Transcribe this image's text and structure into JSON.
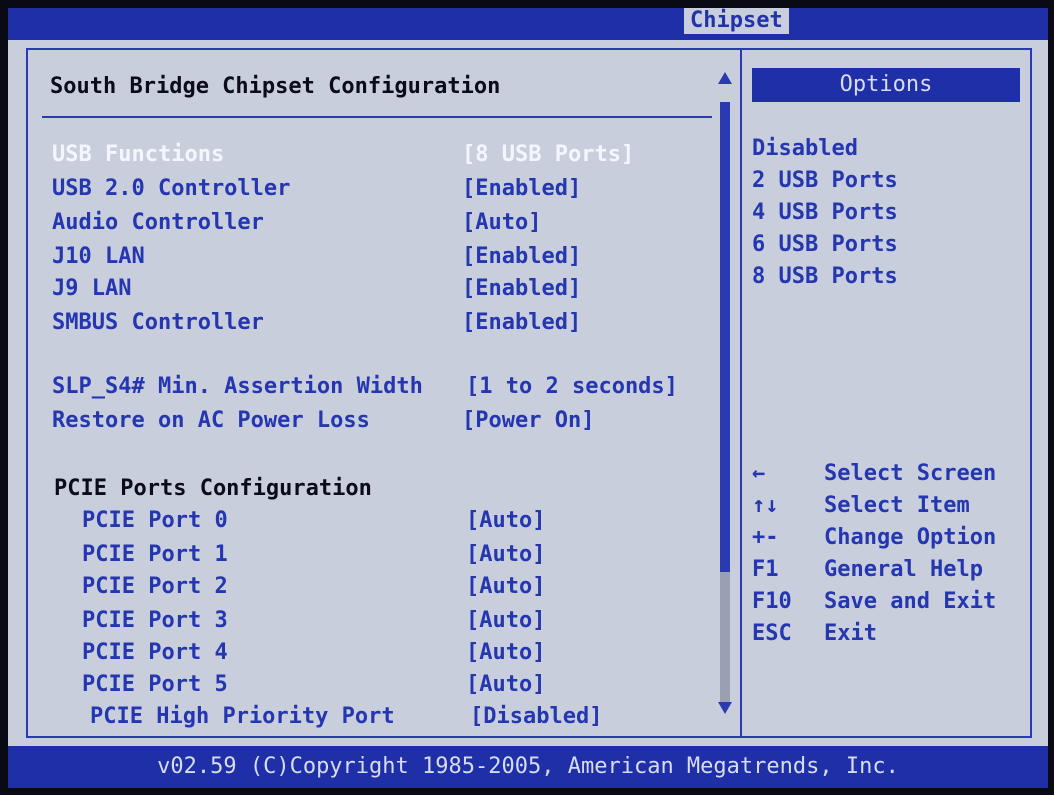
{
  "top_tab": "Chipset",
  "panel": {
    "title": "South Bridge Chipset Configuration",
    "rows": [
      {
        "label": "USB Functions",
        "value": "[8 USB Ports]"
      },
      {
        "label": "USB 2.0 Controller",
        "value": "[Enabled]"
      },
      {
        "label": "Audio Controller",
        "value": "[Auto]"
      },
      {
        "label": "J10 LAN",
        "value": "[Enabled]"
      },
      {
        "label": "J9 LAN",
        "value": "[Enabled]"
      },
      {
        "label": "SMBUS Controller",
        "value": "[Enabled]"
      },
      {
        "label": "SLP_S4# Min. Assertion Width",
        "value": "[1 to 2 seconds]"
      },
      {
        "label": "Restore on AC Power Loss",
        "value": "[Power On]"
      },
      {
        "label": "PCIE Ports Configuration",
        "value": ""
      },
      {
        "label": "PCIE Port 0",
        "value": "[Auto]"
      },
      {
        "label": "PCIE Port 1",
        "value": "[Auto]"
      },
      {
        "label": "PCIE Port 2",
        "value": "[Auto]"
      },
      {
        "label": "PCIE Port 3",
        "value": "[Auto]"
      },
      {
        "label": "PCIE Port 4",
        "value": "[Auto]"
      },
      {
        "label": "PCIE Port 5",
        "value": "[Auto]"
      },
      {
        "label": "PCIE High Priority Port",
        "value": "[Disabled]"
      }
    ]
  },
  "options": {
    "header": "Options",
    "items": [
      "Disabled",
      "2 USB Ports",
      "4 USB Ports",
      "6 USB Ports",
      "8 USB Ports"
    ]
  },
  "help_keys": [
    {
      "key": "←",
      "desc": "Select Screen"
    },
    {
      "key": "↑↓",
      "desc": "Select Item"
    },
    {
      "key": "+-",
      "desc": "Change Option"
    },
    {
      "key": "F1",
      "desc": "General Help"
    },
    {
      "key": "F10",
      "desc": "Save and Exit"
    },
    {
      "key": "ESC",
      "desc": "Exit"
    }
  ],
  "footer": "v02.59 (C)Copyright 1985-2005, American Megatrends, Inc.",
  "colors": {
    "background": "#c9cedd",
    "bar": "#1f2fa8",
    "text": "#2436b0",
    "highlight": "#f4f6ff"
  }
}
